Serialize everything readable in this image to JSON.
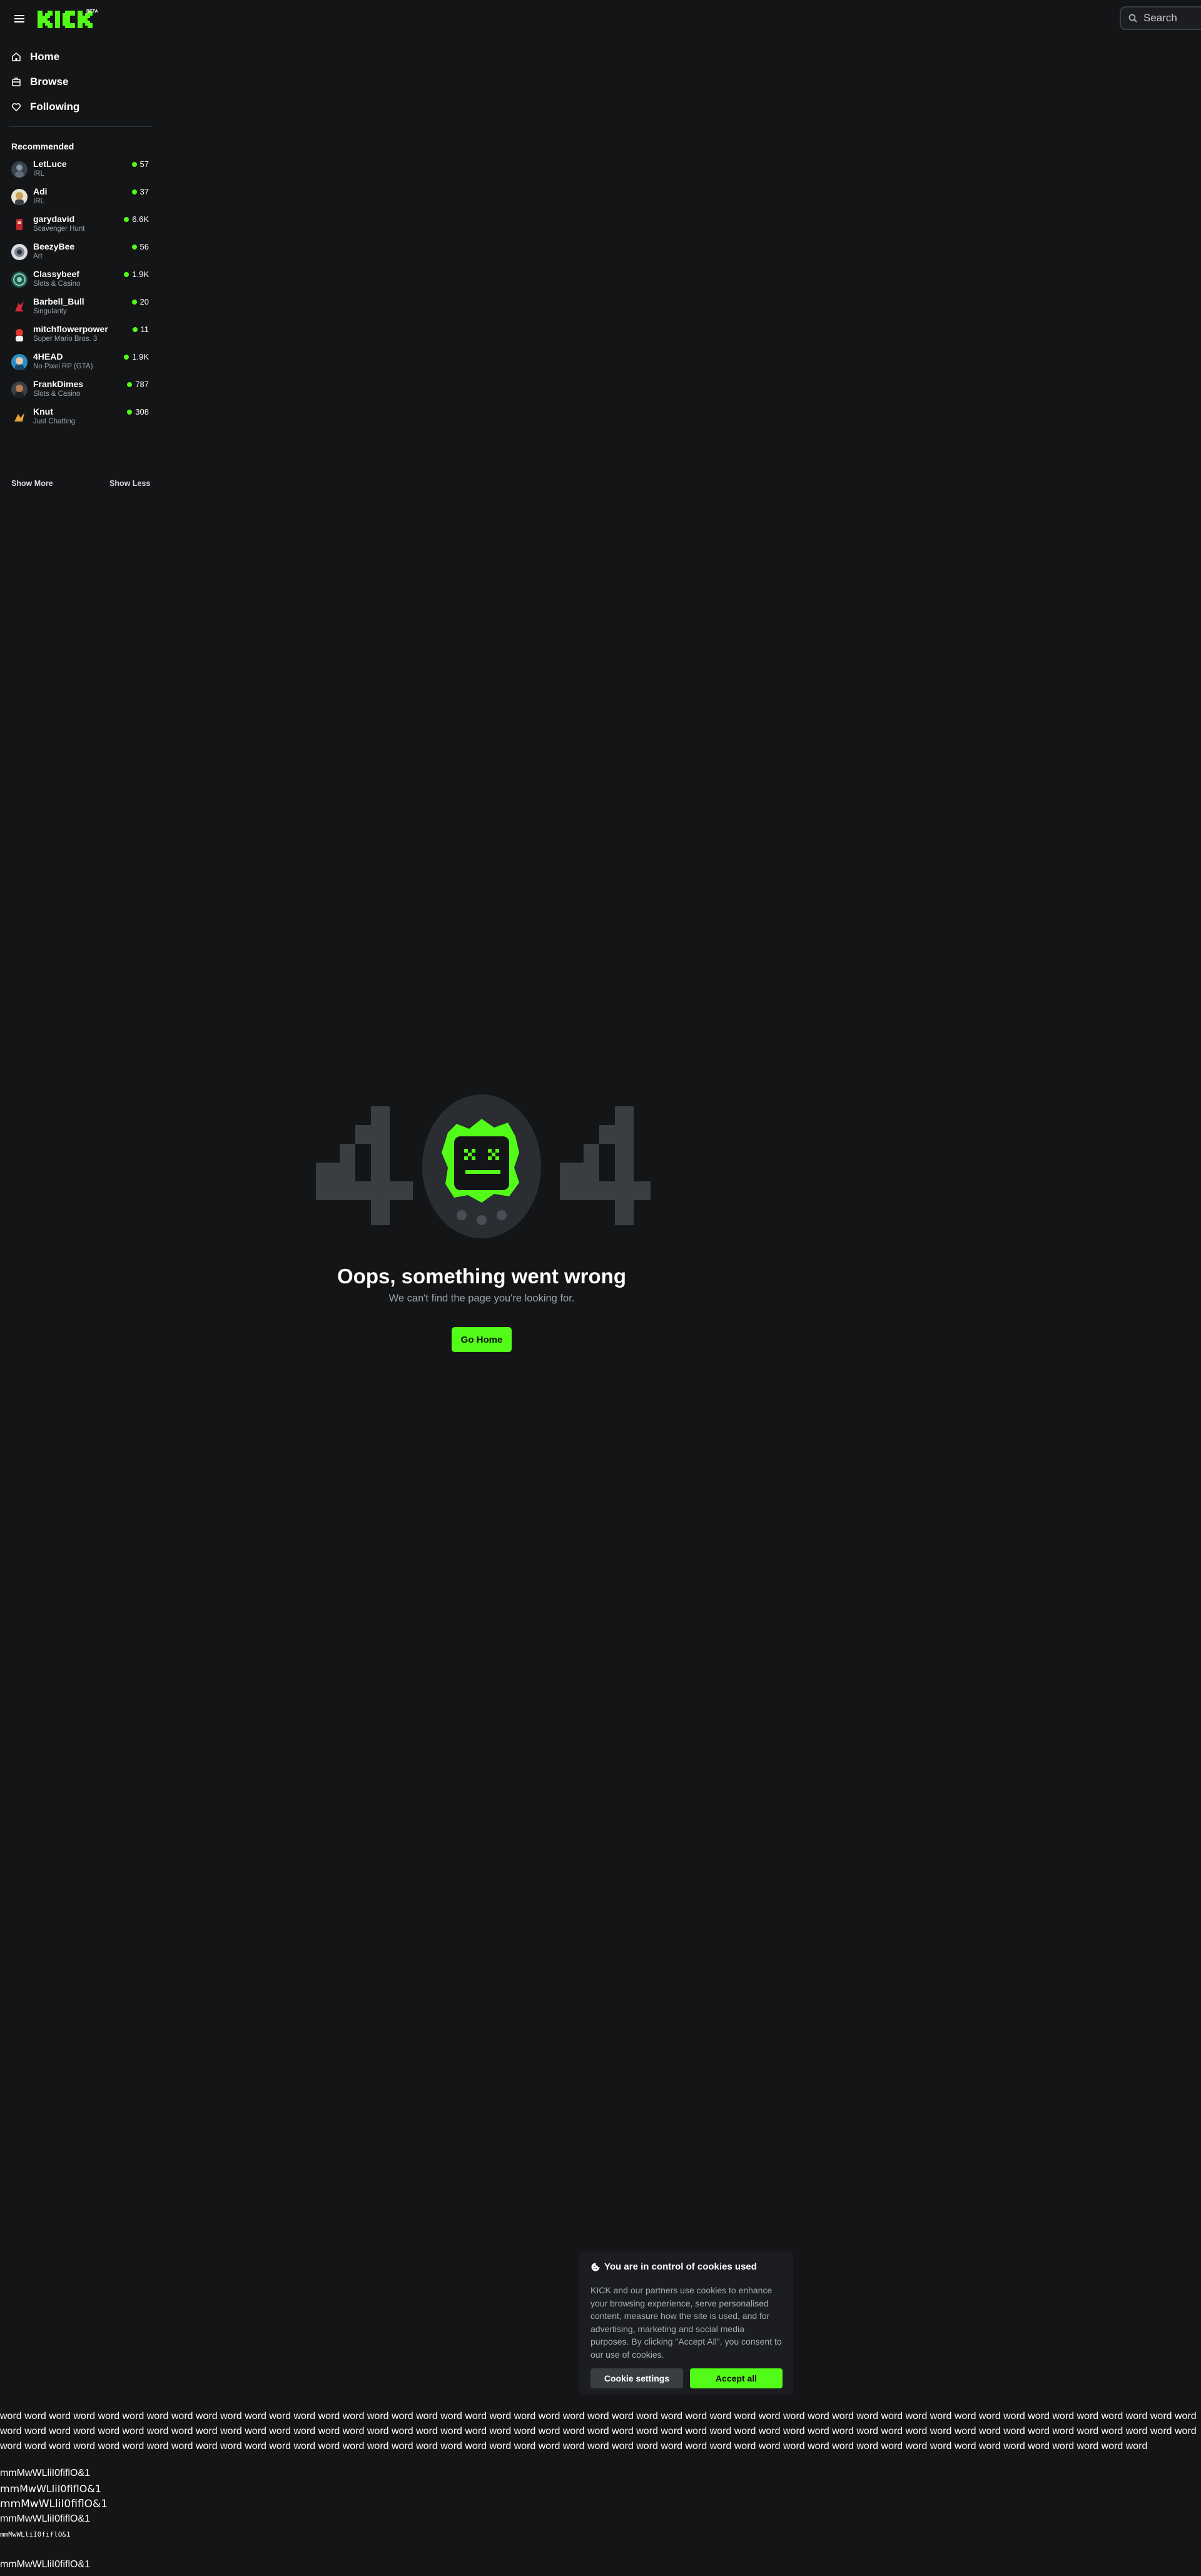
{
  "header": {
    "logo_text": "KICK",
    "logo_badge": "BETA",
    "search_placeholder": "Search"
  },
  "colors": {
    "background": "#141517",
    "accent": "#53fc18",
    "surface": "#1b1d20",
    "muted_text": "#9ea3a8"
  },
  "sidebar": {
    "nav": [
      {
        "label": "Home",
        "icon": "home-icon"
      },
      {
        "label": "Browse",
        "icon": "browse-icon"
      },
      {
        "label": "Following",
        "icon": "heart-icon"
      }
    ],
    "recommended_heading": "Recommended",
    "channels": [
      {
        "name": "LetLuce",
        "category": "IRL",
        "viewers": "57"
      },
      {
        "name": "Adi",
        "category": "IRL",
        "viewers": "37"
      },
      {
        "name": "garydavid",
        "category": "Scavenger Hunt",
        "viewers": "6.6K"
      },
      {
        "name": "BeezyBee",
        "category": "Art",
        "viewers": "56"
      },
      {
        "name": "Classybeef",
        "category": "Slots & Casino",
        "viewers": "1.9K"
      },
      {
        "name": "Barbell_Bull",
        "category": "Singularity",
        "viewers": "20"
      },
      {
        "name": "mitchflowerpower",
        "category": "Super Mario Bros. 3",
        "viewers": "11"
      },
      {
        "name": "4HEAD",
        "category": "No Pixel RP (GTA)",
        "viewers": "1.9K"
      },
      {
        "name": "FrankDimes",
        "category": "Slots & Casino",
        "viewers": "787"
      },
      {
        "name": "Knut",
        "category": "Just Chatting",
        "viewers": "308"
      }
    ],
    "show_more": "Show More",
    "show_less": "Show Less"
  },
  "error": {
    "title": "Oops, something went wrong",
    "subtitle": "We can't find the page you're looking for.",
    "button": "Go Home"
  },
  "cookie": {
    "title": "You are in control of cookies used",
    "body": "KICK and our partners use cookies to enhance your browsing experience, serve personalised content, measure how the site is used, and for advertising, marketing and social media purposes. By clicking \"Accept All\", you consent to our use of cookies.",
    "settings_button": "Cookie settings",
    "accept_button": "Accept all"
  },
  "font_test": {
    "words": "word word word word word word word word word word word word word word word word word word word word word word word word word word word word word word word word word word word word word word word word word word word word word word word word word word word word word word word word word word word word word word word word word word word word word word word word word word word word word word word word word word word word word word word word word word word word word word word word word word word word word word word word word word word word word word word word word word word word word word word word word word word word word word word word word word word word word word word word word word word word word word word word word",
    "line1": "mmMwWLliI0fiflO&1",
    "line2": "mmMwWLliI0fiflO&1",
    "line3": "mmMwWLliI0fiflO&1",
    "line4": "mmMwWLliI0fiflO&1",
    "line5": "mmMwWLliI0fiflO&1",
    "line6": "mmMwWLliI0fiflO&1"
  }
}
